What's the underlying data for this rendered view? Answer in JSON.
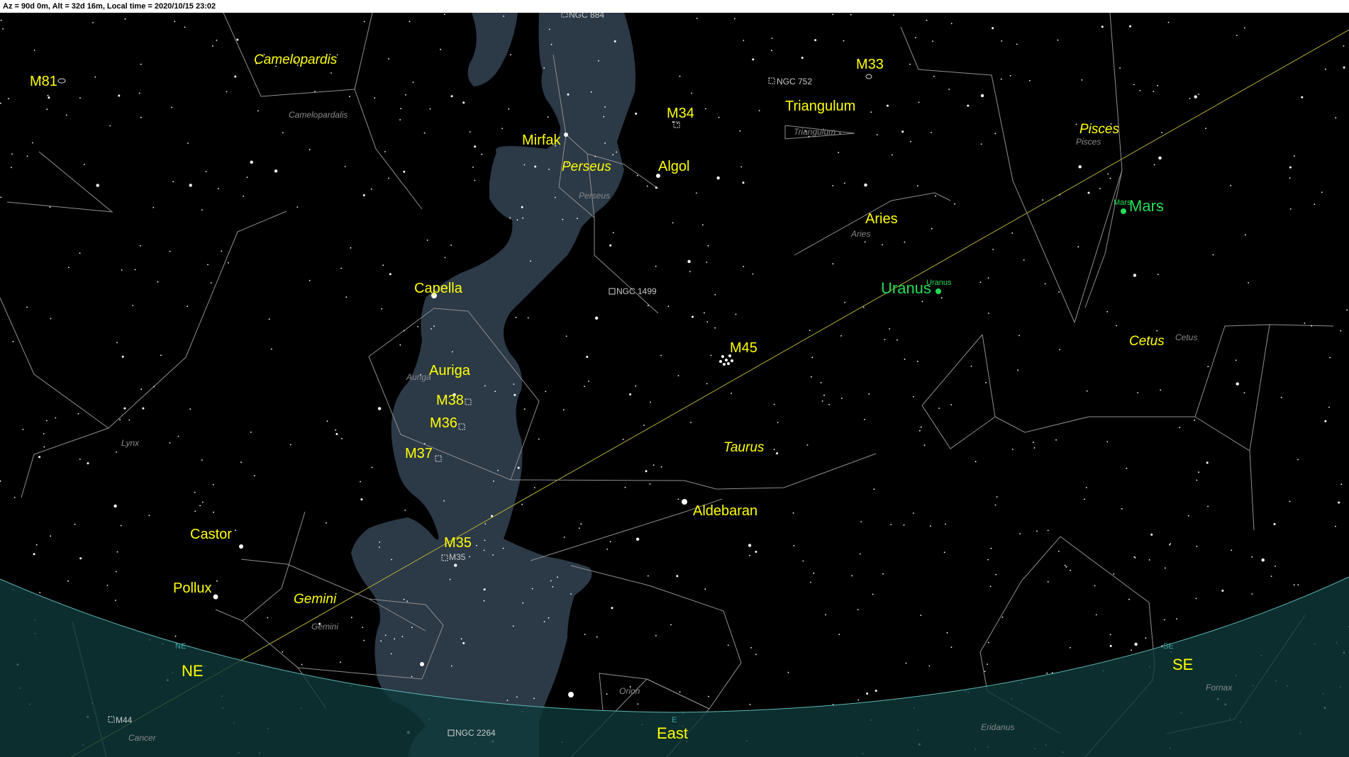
{
  "status": {
    "text": "Az = 90d 0m, Alt = 32d 16m, Local time = 2020/10/15 23:02"
  },
  "colors": {
    "background": "#000000",
    "milky_way": "#2c3947",
    "horizon_fill": "#0f3a3a",
    "horizon_line": "#5fb8b8",
    "constellation_line": "#9a9a9a",
    "ecliptic": "#b5b032",
    "label": "#ffff00",
    "planet": "#22dd55"
  },
  "stars": {
    "capella": "Capella",
    "mirfak": "Mirfak",
    "algol": "Algol",
    "aldebaran": "Aldebaran",
    "castor": "Castor",
    "pollux": "Pollux"
  },
  "constellations": {
    "camelopardis": "Camelopardis",
    "camelopardalis_small": "Camelopardalis",
    "perseus": "Perseus",
    "perseus_small": "Perseus",
    "auriga": "Auriga",
    "auriga_small": "Auriga",
    "triangulum": "Triangulum",
    "triangulum_small": "Triangulum",
    "pisces": "Pisces",
    "pisces_small": "Pisces",
    "aries": "Aries",
    "aries_small": "Aries",
    "cetus": "Cetus",
    "cetus_small": "Cetus",
    "taurus": "Taurus",
    "gemini": "Gemini",
    "gemini_small": "Gemini",
    "lynx_small": "Lynx",
    "orion_small": "Orion",
    "eridanus_small": "Eridanus",
    "fornax_small": "Fornax",
    "cancer_small": "Cancer"
  },
  "deep_sky": {
    "m81": "M81",
    "m33": "M33",
    "m34": "M34",
    "m45": "M45",
    "m38": "M38",
    "m36": "M36",
    "m37": "M37",
    "m35": "M35",
    "m35_small": "M35",
    "m44": "M44",
    "ngc884": "NGC 884",
    "ngc752": "NGC 752",
    "ngc1499": "NGC 1499",
    "ngc2264": "NGC 2264"
  },
  "planets": {
    "mars": "Mars",
    "mars_small": "Mars",
    "uranus": "Uranus",
    "uranus_small": "Uranus"
  },
  "directions": {
    "ne": "NE",
    "ne_small": "NE",
    "east": "East",
    "east_small": "E",
    "se": "SE",
    "se_small": "SE"
  }
}
